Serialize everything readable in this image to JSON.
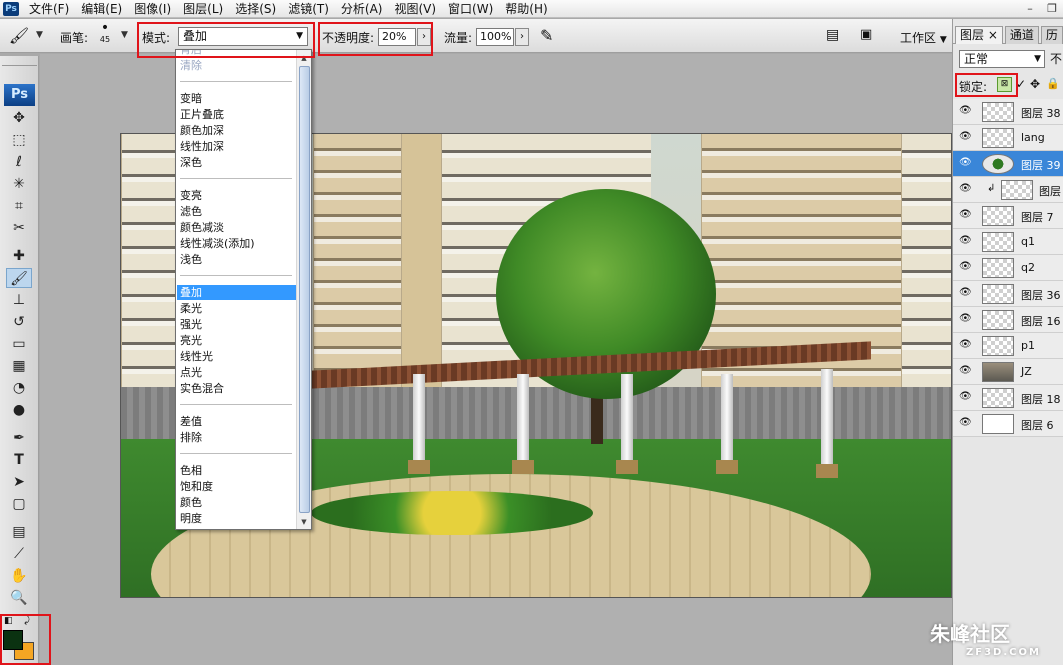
{
  "menubar": {
    "app_icon": "Ps",
    "items": [
      "文件(F)",
      "编辑(E)",
      "图像(I)",
      "图层(L)",
      "选择(S)",
      "滤镜(T)",
      "分析(A)",
      "视图(V)",
      "窗口(W)",
      "帮助(H)"
    ]
  },
  "options": {
    "brush_label": "画笔:",
    "brush_size": "45",
    "mode_label": "模式:",
    "mode_value": "叠加",
    "opacity_label": "不透明度:",
    "opacity_value": "20%",
    "flow_label": "流量:",
    "flow_value": "100%",
    "workspace_label": "工作区"
  },
  "blend_menu": {
    "items": [
      {
        "label": "背后",
        "state": "disabled"
      },
      {
        "label": "清除",
        "state": "disabled"
      },
      {
        "sep": true
      },
      {
        "label": "变暗"
      },
      {
        "label": "正片叠底"
      },
      {
        "label": "颜色加深"
      },
      {
        "label": "线性加深"
      },
      {
        "label": "深色"
      },
      {
        "sep": true
      },
      {
        "label": "变亮"
      },
      {
        "label": "滤色"
      },
      {
        "label": "颜色减淡"
      },
      {
        "label": "线性减淡(添加)"
      },
      {
        "label": "浅色"
      },
      {
        "sep": true
      },
      {
        "label": "叠加",
        "state": "selected"
      },
      {
        "label": "柔光"
      },
      {
        "label": "强光"
      },
      {
        "label": "亮光"
      },
      {
        "label": "线性光"
      },
      {
        "label": "点光"
      },
      {
        "label": "实色混合"
      },
      {
        "sep": true
      },
      {
        "label": "差值"
      },
      {
        "label": "排除"
      },
      {
        "sep": true
      },
      {
        "label": "色相"
      },
      {
        "label": "饱和度"
      },
      {
        "label": "颜色"
      },
      {
        "label": "明度"
      }
    ]
  },
  "layers_panel": {
    "tabs": [
      "图层 ×",
      "通道",
      "历"
    ],
    "blend_mode": "正常",
    "opacity_label": "不",
    "lock_label": "锁定:",
    "layers": [
      {
        "name": "图层 38",
        "thumb": "trans"
      },
      {
        "name": "lang",
        "thumb": "trans"
      },
      {
        "name": "图层 39",
        "thumb": "tree",
        "selected": true
      },
      {
        "name": "图层",
        "thumb": "trans",
        "clipped": true
      },
      {
        "name": "图层 7",
        "thumb": "trans"
      },
      {
        "name": "q1",
        "thumb": "trans"
      },
      {
        "name": "q2",
        "thumb": "trans"
      },
      {
        "name": "图层 36",
        "thumb": "trans"
      },
      {
        "name": "图层 16",
        "thumb": "trans"
      },
      {
        "name": "p1",
        "thumb": "trans"
      },
      {
        "name": "JZ",
        "thumb": "photo"
      },
      {
        "name": "图层 18",
        "thumb": "trans"
      },
      {
        "name": "图层 6",
        "thumb": "white"
      }
    ]
  },
  "colors": {
    "foreground": "#0b3211",
    "background": "#f5a623",
    "highlight": "#e0141a"
  },
  "watermark": {
    "main": "朱峰社区",
    "sub": "ZF3D.COM"
  }
}
